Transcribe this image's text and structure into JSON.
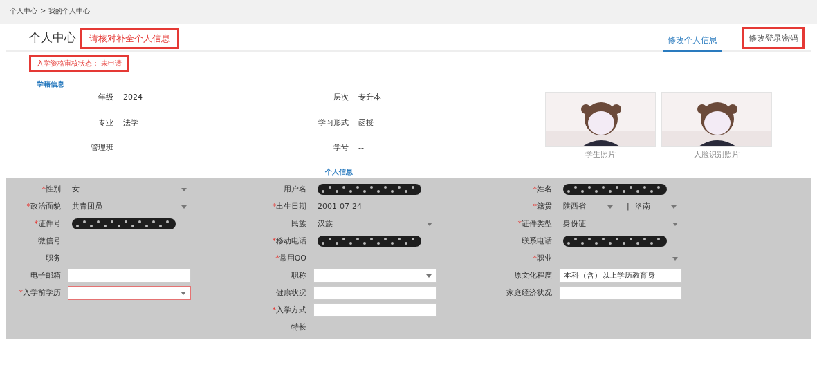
{
  "breadcrumb": {
    "items": [
      "个人中心",
      "我的个人中心"
    ],
    "separator": ">"
  },
  "header": {
    "title": "个人中心",
    "notice": {
      "text": "请核对补全个人信息",
      "highlighted": true
    }
  },
  "tabs": [
    {
      "label": "修改个人信息",
      "selected": true,
      "highlighted": false
    },
    {
      "label": "修改登录密码",
      "selected": false,
      "highlighted": true
    }
  ],
  "status": {
    "text": "入学资格审核状态： 未申请",
    "highlighted": true
  },
  "enrollment": {
    "heading": "学籍信息",
    "fields": [
      {
        "label": "年级",
        "value": "2024"
      },
      {
        "label": "层次",
        "value": "专升本"
      },
      {
        "label": "专业",
        "value": "法学"
      },
      {
        "label": "学习形式",
        "value": "函授"
      },
      {
        "label": "管理班"
      },
      {
        "label": "学号",
        "value": "--"
      }
    ],
    "photos": [
      {
        "caption": "学生照片"
      },
      {
        "caption": "人脸识别照片"
      }
    ]
  },
  "personal": {
    "heading": "个人信息",
    "required_symbol": "*",
    "rows": [
      [
        {
          "label": "性别",
          "required": true,
          "kind": "display-select",
          "value": "女"
        },
        {
          "label": "用户名",
          "required": false,
          "kind": "redacted"
        },
        {
          "label": "姓名",
          "required": true,
          "kind": "redacted"
        }
      ],
      [
        {
          "label": "政治面貌",
          "required": true,
          "kind": "display-select",
          "value": "共青团员"
        },
        {
          "label": "出生日期",
          "required": true,
          "kind": "display",
          "value": "2001-07-24"
        },
        {
          "label": "籍贯",
          "required": true,
          "kind": "double-select",
          "values": [
            "陕西省",
            "|--洛南"
          ]
        }
      ],
      [
        {
          "label": "证件号",
          "required": true,
          "kind": "redacted"
        },
        {
          "label": "民族",
          "required": false,
          "kind": "display-select",
          "value": "汉族"
        },
        {
          "label": "证件类型",
          "required": true,
          "kind": "display-select",
          "value": "身份证"
        }
      ],
      [
        {
          "label": "微信号",
          "required": false,
          "kind": "display"
        },
        {
          "label": "移动电话",
          "required": true,
          "kind": "redacted"
        },
        {
          "label": "联系电话",
          "required": false,
          "kind": "redacted"
        }
      ],
      [
        {
          "label": "职务",
          "required": false,
          "kind": "display"
        },
        {
          "label": "常用QQ",
          "required": true,
          "kind": "display"
        },
        {
          "label": "职业",
          "required": true,
          "kind": "display-select"
        }
      ],
      [
        {
          "label": "电子邮箱",
          "required": false,
          "kind": "input"
        },
        {
          "label": "职称",
          "required": false,
          "kind": "select"
        },
        {
          "label": "原文化程度",
          "required": false,
          "kind": "input",
          "value": "本科（含）以上学历教育身"
        }
      ],
      [
        {
          "label": "入学前学历",
          "required": true,
          "kind": "select",
          "invalid": true
        },
        {
          "label": "健康状况",
          "required": false,
          "kind": "input"
        },
        {
          "label": "家庭经济状况",
          "required": false,
          "kind": "input"
        }
      ],
      [
        null,
        {
          "label": "入学方式",
          "required": true,
          "kind": "input"
        },
        null
      ],
      [
        null,
        {
          "label": "特长",
          "required": false,
          "kind": "display"
        },
        null
      ]
    ]
  }
}
